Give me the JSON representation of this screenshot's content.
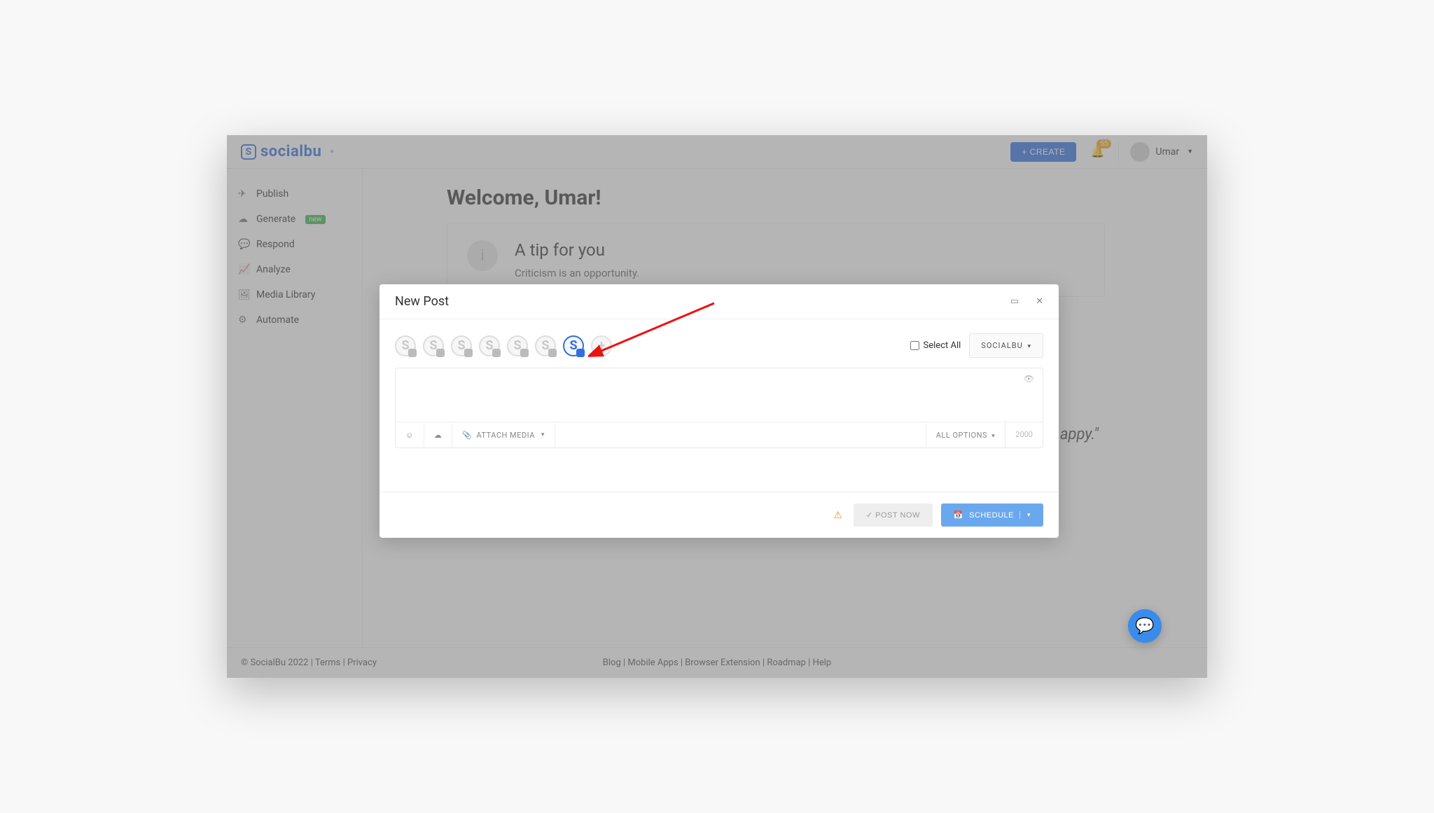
{
  "brand": {
    "name": "socialbu"
  },
  "topbar": {
    "create_label": "+ CREATE",
    "notif_count": 55,
    "user_name": "Umar"
  },
  "sidebar": {
    "items": [
      {
        "icon": "✈",
        "label": "Publish"
      },
      {
        "icon": "☁",
        "label": "Generate",
        "tag": "new"
      },
      {
        "icon": "💬",
        "label": "Respond"
      },
      {
        "icon": "📈",
        "label": "Analyze"
      },
      {
        "icon": "🖼",
        "label": "Media Library"
      },
      {
        "icon": "⚙",
        "label": "Automate"
      }
    ]
  },
  "main": {
    "welcome": "Welcome, Umar!",
    "tip_title": "A tip for you",
    "tip_body": "Criticism is an opportunity.",
    "partial_text": "appy.\""
  },
  "modal": {
    "title": "New Post",
    "select_all_label": "Select All",
    "source_dropdown": "SOCIALBU",
    "attach_label": "ATTACH MEDIA",
    "options_label": "ALL OPTIONS",
    "char_limit": "2000",
    "post_now_label": "POST NOW",
    "schedule_label": "SCHEDULE",
    "accounts": [
      {
        "selected": false,
        "sub": "tw"
      },
      {
        "selected": false,
        "sub": "fb"
      },
      {
        "selected": false,
        "sub": "ig"
      },
      {
        "selected": false,
        "sub": "in"
      },
      {
        "selected": false,
        "sub": "gb"
      },
      {
        "selected": false,
        "sub": "in"
      },
      {
        "selected": true,
        "sub": "ig"
      }
    ]
  },
  "footer": {
    "left": "© SocialBu 2022 | Terms | Privacy",
    "center": "Blog | Mobile Apps | Browser Extension | Roadmap | Help"
  }
}
